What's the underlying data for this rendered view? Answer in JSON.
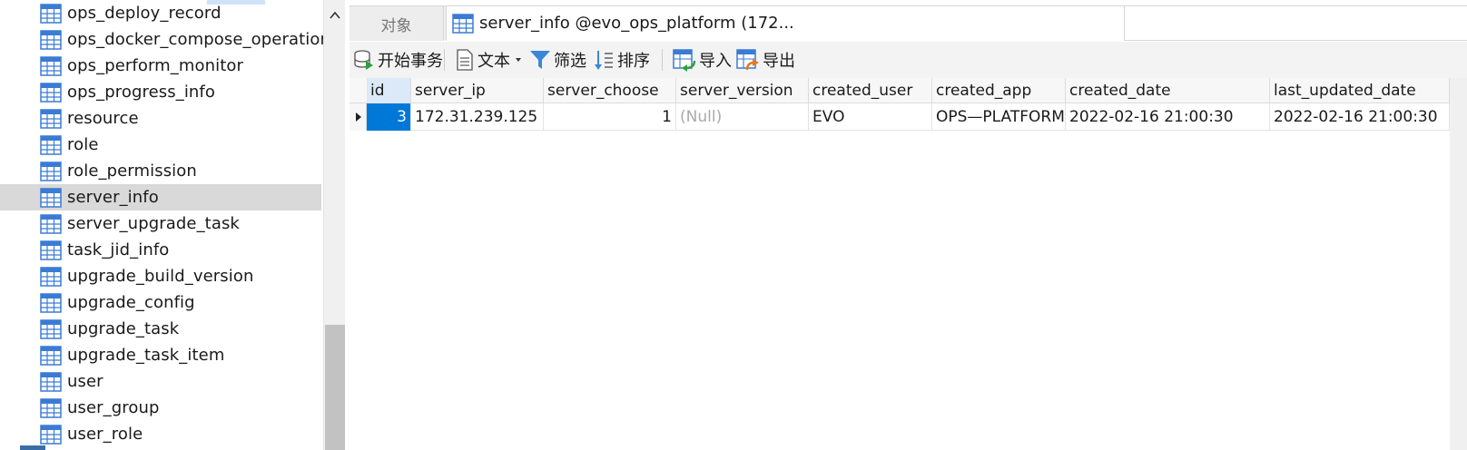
{
  "tree": {
    "items": [
      {
        "label": "ops_deploy_record",
        "selected": false
      },
      {
        "label": "ops_docker_compose_operation_",
        "selected": false
      },
      {
        "label": "ops_perform_monitor",
        "selected": false
      },
      {
        "label": "ops_progress_info",
        "selected": false
      },
      {
        "label": "resource",
        "selected": false
      },
      {
        "label": "role",
        "selected": false
      },
      {
        "label": "role_permission",
        "selected": false
      },
      {
        "label": "server_info",
        "selected": true
      },
      {
        "label": "server_upgrade_task",
        "selected": false
      },
      {
        "label": "task_jid_info",
        "selected": false
      },
      {
        "label": "upgrade_build_version",
        "selected": false
      },
      {
        "label": "upgrade_config",
        "selected": false
      },
      {
        "label": "upgrade_task",
        "selected": false
      },
      {
        "label": "upgrade_task_item",
        "selected": false
      },
      {
        "label": "user",
        "selected": false
      },
      {
        "label": "user_group",
        "selected": false
      },
      {
        "label": "user_role",
        "selected": false
      }
    ]
  },
  "tabs": {
    "objects_label": "对象",
    "server_tab_label": "server_info @evo_ops_platform (172..."
  },
  "toolbar": {
    "begin_transaction": "开始事务",
    "text": "文本",
    "filter": "筛选",
    "sort": "排序",
    "import": "导入",
    "export": "导出"
  },
  "grid": {
    "columns": [
      "id",
      "server_ip",
      "server_choose",
      "server_version",
      "created_user",
      "created_app",
      "created_date",
      "last_updated_date"
    ],
    "rows": [
      [
        "3",
        "172.31.239.125",
        "1",
        "(Null)",
        "EVO",
        "OPS—PLATFORM",
        "2022-02-16 21:00:30",
        "2022-02-16 21:00:30"
      ]
    ]
  },
  "colors": {
    "selection": "#0078d7",
    "tree_selected": "#d9d9d9",
    "null_text": "#aaaaaa",
    "icon_blue": "#3a7bd5"
  }
}
